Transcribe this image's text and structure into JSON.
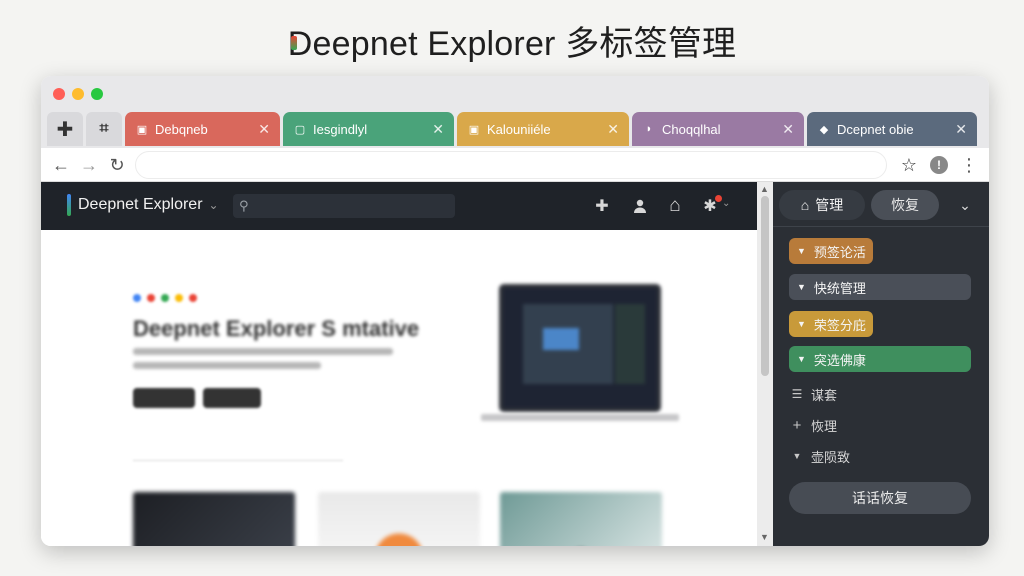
{
  "headline": {
    "brand": "D",
    "title": "eepnet Explorer 多标签管理"
  },
  "window": {
    "traffic_lights": [
      "#ff5f57",
      "#febc2e",
      "#28c840"
    ],
    "controls": [
      {
        "name": "plus-icon",
        "glyph": "✚"
      },
      {
        "name": "grip-icon",
        "glyph": "⌗"
      }
    ],
    "tabs": [
      {
        "label": "Debqneb",
        "color": "#d9685c",
        "icon": "▣"
      },
      {
        "label": "Iesgindlyl",
        "color": "#4aa37a",
        "icon": "▢"
      },
      {
        "label": "Kalouniiéle",
        "color": "#d9a84a",
        "icon": "▣"
      },
      {
        "label": "Choqqlhal",
        "color": "#9a7aa3",
        "icon": "◗"
      },
      {
        "label": "Dcepnet obie",
        "color": "#5b6a7d",
        "icon": "◆"
      }
    ],
    "tab_close": "✕"
  },
  "addressbar": {
    "back": "←",
    "forward": "→",
    "reload": "↻",
    "url": "",
    "star": "☆",
    "ext": "!",
    "menu": "⋮"
  },
  "site": {
    "logo": "Deepnet Explorer",
    "logo_caret": "⌄",
    "search_icon": "⚲",
    "icons": {
      "add": "✚",
      "user": "●",
      "home": "⌂",
      "settings": "✱"
    },
    "hero_title": "Deepnet Explorer S mtative",
    "dot_colors": [
      "#4285f4",
      "#ea4335",
      "#34a853",
      "#fbbc05",
      "#ea4335"
    ]
  },
  "panel": {
    "tab_manage": "管理",
    "tab_restore": "恢复",
    "collapse": "⌄",
    "chips": [
      {
        "label": "预签论活",
        "bg": "#b87b3a",
        "arrow": "▼"
      },
      {
        "label": "快统管理",
        "bg": "#4a4f58",
        "arrow": "▼"
      },
      {
        "label": "荣签分庇",
        "bg": "#c89a3a",
        "arrow": "▼"
      },
      {
        "label": "突选佛康",
        "bg": "#3f8f5e",
        "arrow": "▼"
      }
    ],
    "items": [
      {
        "icon": "☰",
        "label": "谋套"
      },
      {
        "icon": "+",
        "label": "恢理"
      },
      {
        "icon": "▼",
        "label": "壶陨致"
      }
    ],
    "restore_button": "话话恢复"
  }
}
